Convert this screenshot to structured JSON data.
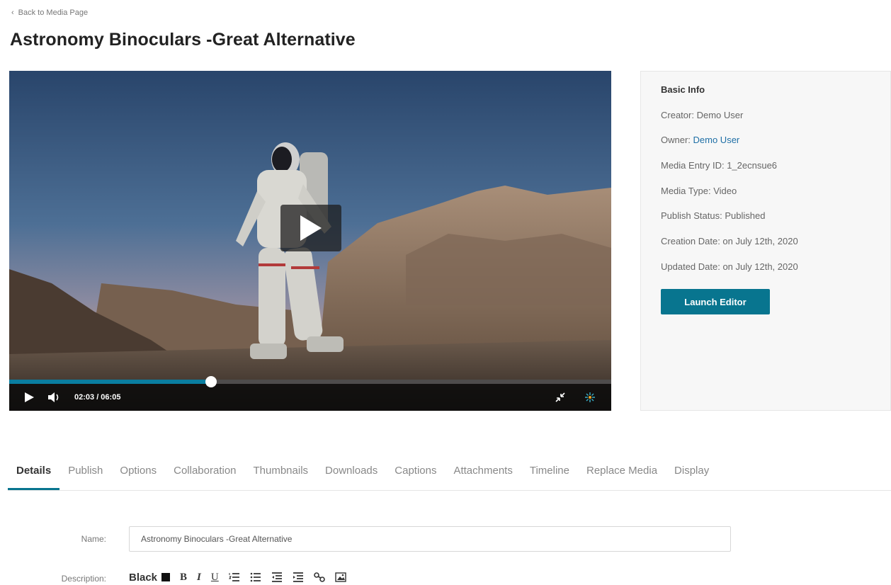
{
  "nav": {
    "back_label": "Back to Media Page"
  },
  "page": {
    "title": "Astronomy Binoculars -Great Alternative"
  },
  "player": {
    "time_display": "02:03 / 06:05",
    "progress": 0.335
  },
  "basic_info": {
    "heading": "Basic Info",
    "creator": "Creator: Demo User",
    "owner_label": "Owner: ",
    "owner_value": "Demo User",
    "entry_id": "Media Entry ID: 1_2ecnsue6",
    "media_type": "Media Type: Video",
    "publish_status": "Publish Status: Published",
    "creation_date": "Creation Date: on July 12th, 2020",
    "updated_date": "Updated Date: on July 12th, 2020",
    "launch_button": "Launch Editor"
  },
  "tabs": [
    {
      "label": "Details"
    },
    {
      "label": "Publish"
    },
    {
      "label": "Options"
    },
    {
      "label": "Collaboration"
    },
    {
      "label": "Thumbnails"
    },
    {
      "label": "Downloads"
    },
    {
      "label": "Captions"
    },
    {
      "label": "Attachments"
    },
    {
      "label": "Timeline"
    },
    {
      "label": "Replace Media"
    },
    {
      "label": "Display"
    }
  ],
  "form": {
    "name_label": "Name:",
    "name_value": "Astronomy Binoculars -Great Alternative",
    "description_label": "Description:",
    "color_select": "Black"
  },
  "colors": {
    "accent": "#08758f",
    "link": "#1f6fa6"
  }
}
